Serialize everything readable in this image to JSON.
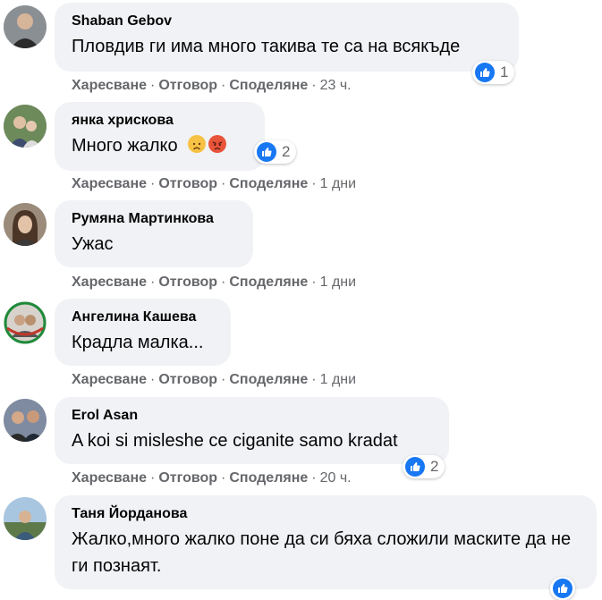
{
  "actions": {
    "like": "Харесване",
    "reply": "Отговор",
    "share": "Споделяне",
    "sep": "·"
  },
  "comments": [
    {
      "author": "Shaban Gebov",
      "text": "Пловдив ги има много такива те са на всякъде",
      "time": "23 ч.",
      "reactions": "1"
    },
    {
      "author": "янка хрискова",
      "text": "Много жалко",
      "emojis": [
        "sad-face",
        "angry-face"
      ],
      "time": "1 дни",
      "reactions": "2"
    },
    {
      "author": "Румяна Мартинкова",
      "text": "Ужас",
      "time": "1 дни"
    },
    {
      "author": "Ангелина Кашева",
      "text": "Крадла малка...",
      "time": "1 дни"
    },
    {
      "author": "Erol Asan",
      "text": "A koi si misleshe ce ciganite samo kradat",
      "time": "20 ч.",
      "reactions": "2"
    },
    {
      "author": "Таня Йорданова",
      "text": "Жалко,много жалко поне да си бяха сложили маските да не ги познаят."
    }
  ],
  "colors": {
    "bubble": "#f0f2f5",
    "like": "#1877f2",
    "meta": "#65676b",
    "text": "#050505"
  }
}
